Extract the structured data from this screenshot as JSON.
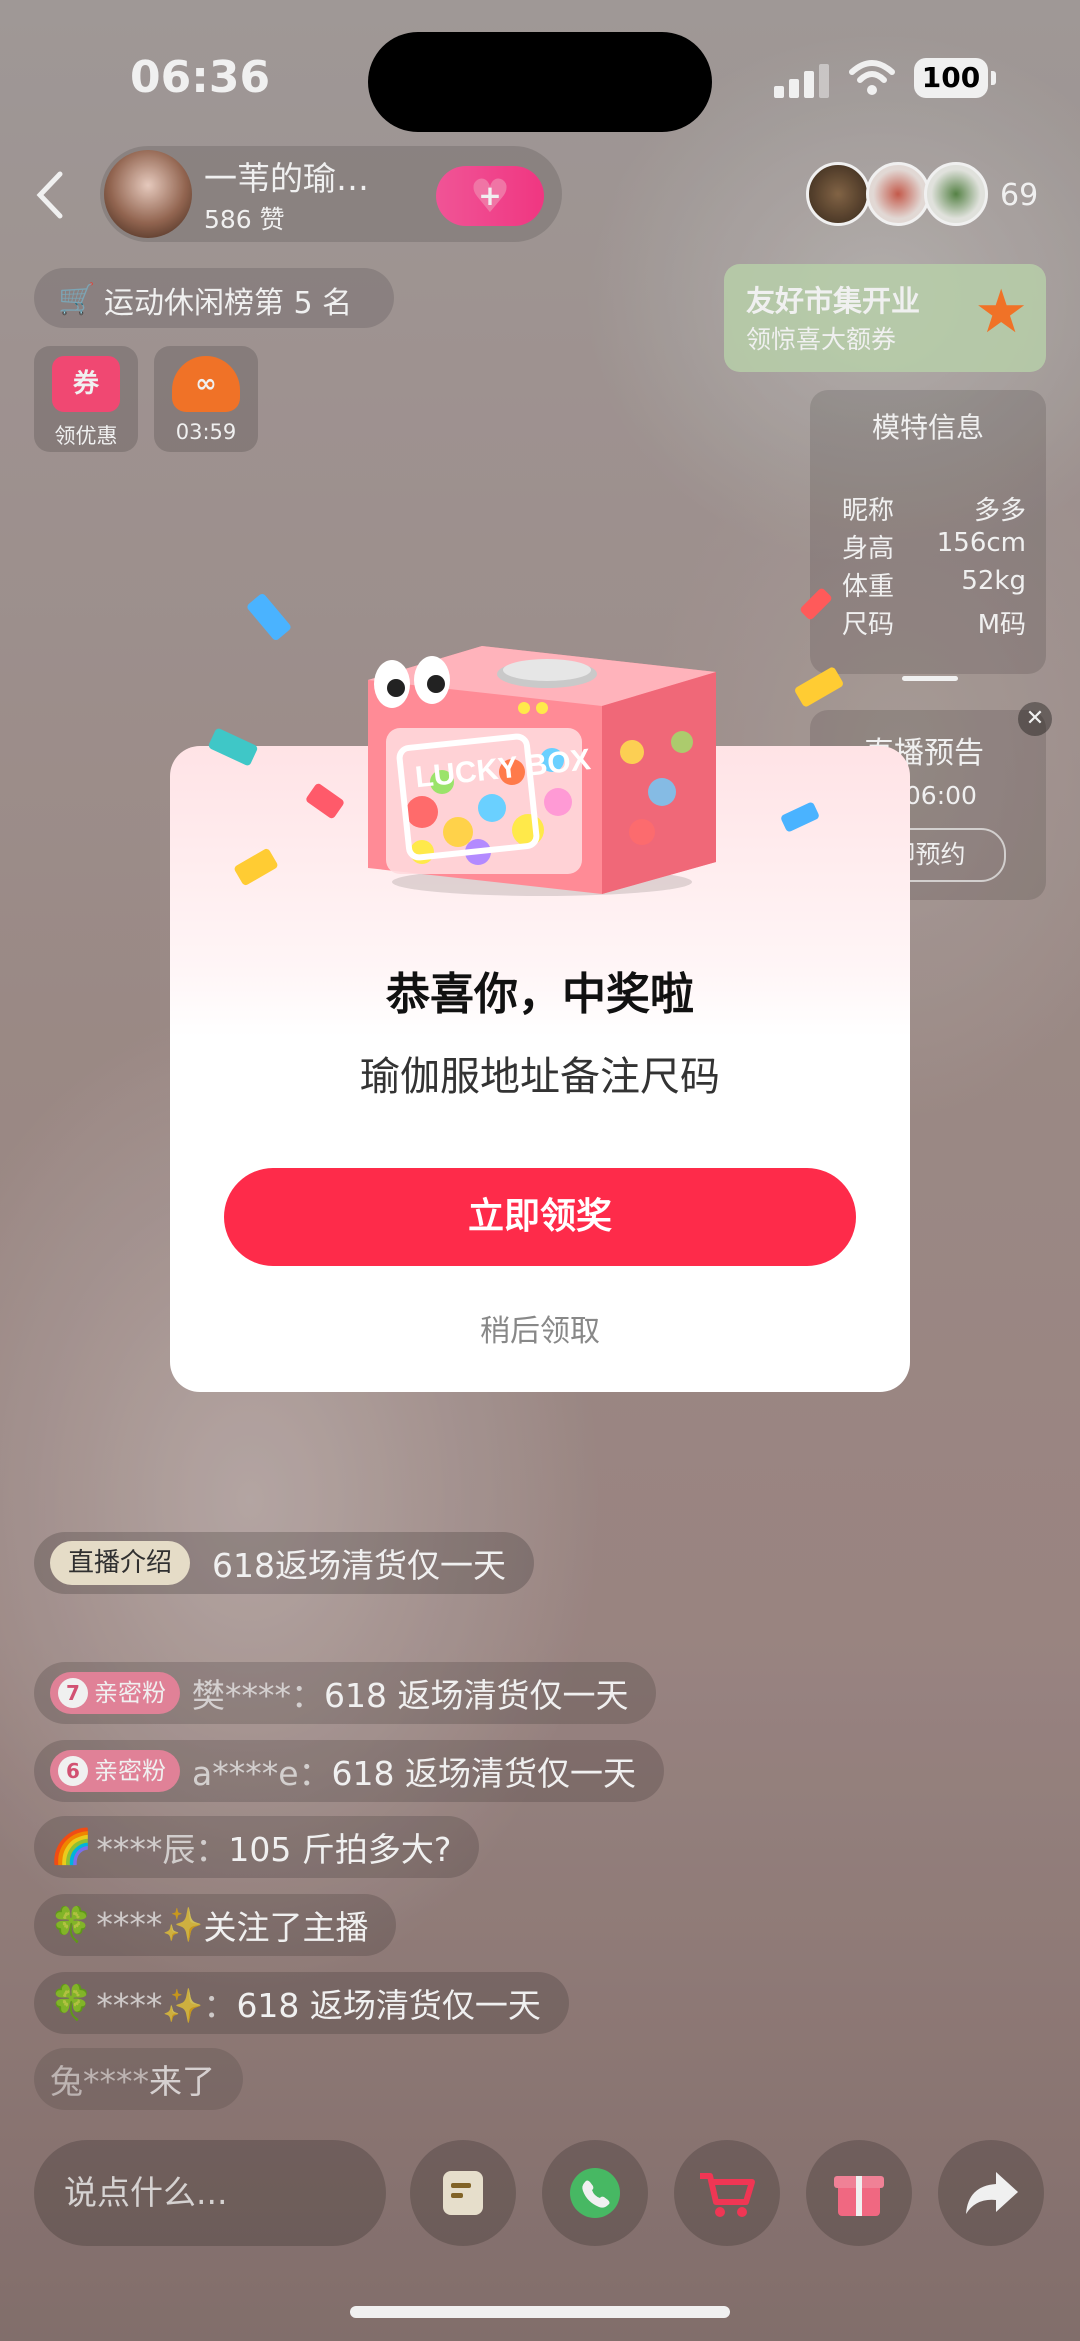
{
  "status_bar": {
    "time": "06:36",
    "battery": "100"
  },
  "header": {
    "host_name": "一苇的瑜…",
    "likes": "586 赞",
    "viewer_count": "69",
    "ranking": "运动休闲榜第 5 名"
  },
  "tiles": [
    {
      "icon_label": "券",
      "label": "领优惠"
    },
    {
      "label": "03:59"
    }
  ],
  "market_banner": {
    "title": "友好市集开业",
    "subtitle": "领惊喜大额券"
  },
  "model_info": {
    "title": "模特信息",
    "rows": [
      {
        "key": "昵称",
        "value": "多多"
      },
      {
        "key": "身高",
        "value": "156cm"
      },
      {
        "key": "体重",
        "value": "52kg"
      },
      {
        "key": "尺码",
        "value": "M码"
      }
    ]
  },
  "live_preview": {
    "title": "直播预告",
    "date": "4日06:00",
    "button": "即预约"
  },
  "modal": {
    "box_text": "LUCKY BOX",
    "title": "恭喜你，中奖啦",
    "subtitle": "瑜伽服地址备注尺码",
    "claim_button": "立即领奖",
    "later_button": "稍后领取"
  },
  "live_intro": {
    "tag": "直播介绍",
    "text": "618返场清货仅一天"
  },
  "comments": [
    {
      "badge_level": "7",
      "badge": "亲密粉",
      "user": "樊****：",
      "text": "618 返场清货仅一天"
    },
    {
      "badge_level": "6",
      "badge": "亲密粉",
      "user": "a****e：",
      "text": "618 返场清货仅一天"
    },
    {
      "emoji": "🌈",
      "user": "****辰：",
      "text": "105 斤拍多大?"
    },
    {
      "emoji": "🍀",
      "user": "****✨",
      "text": " 关注了主播"
    },
    {
      "emoji": "🍀",
      "user": "****✨：",
      "text": "618 返场清货仅一天"
    },
    {
      "user": "兔****",
      "text": " 来了"
    }
  ],
  "bottom_bar": {
    "input_placeholder": "说点什么..."
  },
  "colors": {
    "accent": "#fe2b4a",
    "fan_badge": "#ee8aa1",
    "market_bg": "#c3dcb4"
  }
}
